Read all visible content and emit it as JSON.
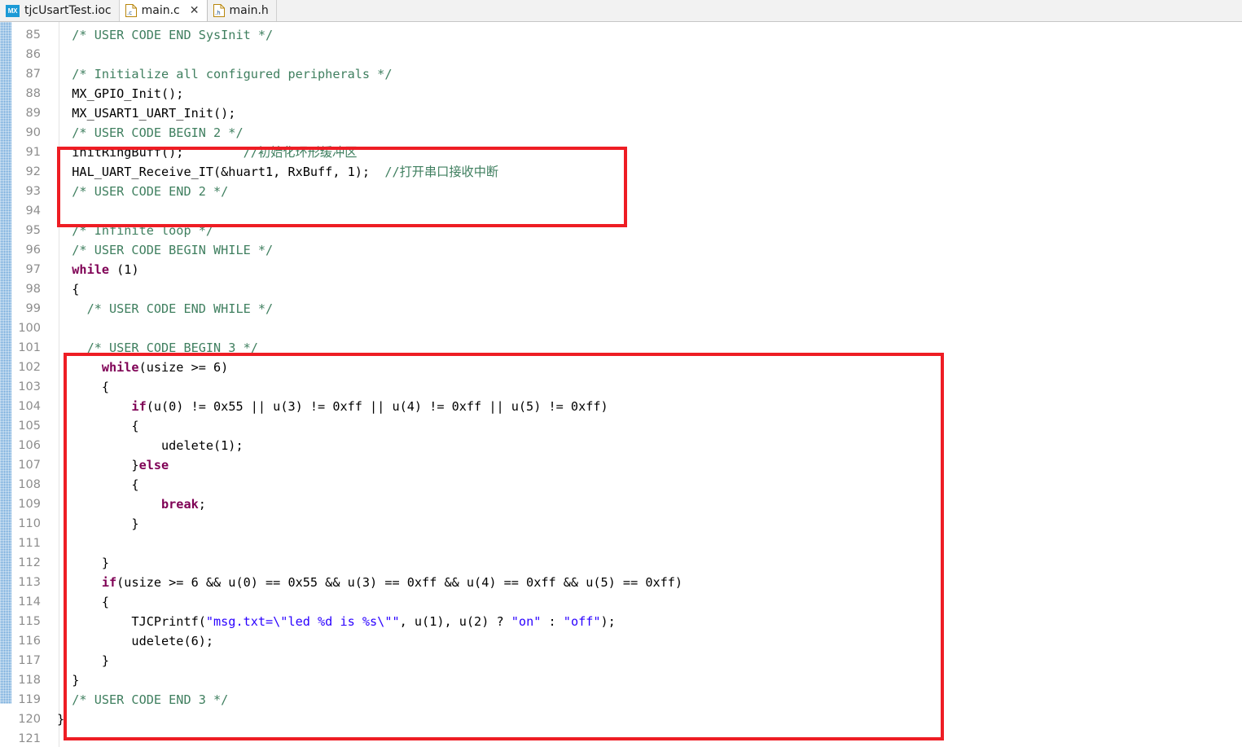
{
  "window": {
    "app": "Eclipse CDT editor",
    "file_type": "C source"
  },
  "tabs": [
    {
      "label": "tjcUsartTest.ioc",
      "icon": "cubemx-icon",
      "active": false,
      "closable": false
    },
    {
      "label": "main.c",
      "icon": "c-file-icon",
      "active": true,
      "closable": true,
      "close_glyph": "✕"
    },
    {
      "label": "main.h",
      "icon": "h-file-icon",
      "active": false,
      "closable": false
    }
  ],
  "colors": {
    "comment": "#3f7f5f",
    "keyword": "#7f0055",
    "string": "#2a00ff",
    "plain": "#000000",
    "line_number": "#8d8d8d",
    "annotation_box": "#ee1d24",
    "change_bar": "#5a9bd5",
    "editor_background": "#ffffff",
    "tabbar_background": "#f2f2f2"
  },
  "annotations": [
    {
      "name": "usercode-begin-2-highlight",
      "covers_lines": "90-93"
    },
    {
      "name": "usercode-begin-3-highlight",
      "covers_lines": "100-120"
    }
  ],
  "editor": {
    "first_visible_line": 85,
    "last_visible_line": 121,
    "lines": [
      {
        "n": "85",
        "tokens": [
          {
            "t": "cmt",
            "s": "  /* USER CODE END SysInit */"
          }
        ]
      },
      {
        "n": "86",
        "tokens": [
          {
            "t": "pl",
            "s": ""
          }
        ]
      },
      {
        "n": "87",
        "tokens": [
          {
            "t": "cmt",
            "s": "  /* Initialize all configured peripherals */"
          }
        ]
      },
      {
        "n": "88",
        "tokens": [
          {
            "t": "pl",
            "s": "  MX_GPIO_Init();"
          }
        ]
      },
      {
        "n": "89",
        "tokens": [
          {
            "t": "pl",
            "s": "  MX_USART1_UART_Init();"
          }
        ]
      },
      {
        "n": "90",
        "tokens": [
          {
            "t": "cmt",
            "s": "  /* USER CODE BEGIN 2 */"
          }
        ]
      },
      {
        "n": "91",
        "tokens": [
          {
            "t": "pl",
            "s": "  initRingBuff();        "
          },
          {
            "t": "cmt",
            "s": "//初始化环形缓冲区"
          }
        ]
      },
      {
        "n": "92",
        "tokens": [
          {
            "t": "pl",
            "s": "  HAL_UART_Receive_IT(&huart1, RxBuff, 1);  "
          },
          {
            "t": "cmt",
            "s": "//打开串口接收中断"
          }
        ]
      },
      {
        "n": "93",
        "tokens": [
          {
            "t": "cmt",
            "s": "  /* USER CODE END 2 */"
          }
        ]
      },
      {
        "n": "94",
        "tokens": [
          {
            "t": "pl",
            "s": ""
          }
        ]
      },
      {
        "n": "95",
        "tokens": [
          {
            "t": "cmt",
            "s": "  /* Infinite loop */"
          }
        ]
      },
      {
        "n": "96",
        "tokens": [
          {
            "t": "cmt",
            "s": "  /* USER CODE BEGIN WHILE */"
          }
        ]
      },
      {
        "n": "97",
        "tokens": [
          {
            "t": "kw",
            "s": "  while"
          },
          {
            "t": "pl",
            "s": " (1)"
          }
        ]
      },
      {
        "n": "98",
        "tokens": [
          {
            "t": "pl",
            "s": "  {"
          }
        ]
      },
      {
        "n": "99",
        "tokens": [
          {
            "t": "cmt",
            "s": "    /* USER CODE END WHILE */"
          }
        ]
      },
      {
        "n": "100",
        "tokens": [
          {
            "t": "pl",
            "s": ""
          }
        ]
      },
      {
        "n": "101",
        "tokens": [
          {
            "t": "cmt",
            "s": "    /* USER CODE BEGIN 3 */"
          }
        ]
      },
      {
        "n": "102",
        "tokens": [
          {
            "t": "kw",
            "s": "      while"
          },
          {
            "t": "pl",
            "s": "(usize >= 6)"
          }
        ]
      },
      {
        "n": "103",
        "tokens": [
          {
            "t": "pl",
            "s": "      {"
          }
        ]
      },
      {
        "n": "104",
        "tokens": [
          {
            "t": "kw",
            "s": "          if"
          },
          {
            "t": "pl",
            "s": "(u(0) != 0x55 || u(3) != 0xff || u(4) != 0xff || u(5) != 0xff)"
          }
        ]
      },
      {
        "n": "105",
        "tokens": [
          {
            "t": "pl",
            "s": "          {"
          }
        ]
      },
      {
        "n": "106",
        "tokens": [
          {
            "t": "pl",
            "s": "              udelete(1);"
          }
        ]
      },
      {
        "n": "107",
        "tokens": [
          {
            "t": "pl",
            "s": "          }"
          },
          {
            "t": "kw",
            "s": "else"
          }
        ]
      },
      {
        "n": "108",
        "tokens": [
          {
            "t": "pl",
            "s": "          {"
          }
        ]
      },
      {
        "n": "109",
        "tokens": [
          {
            "t": "pl",
            "s": "              "
          },
          {
            "t": "kw",
            "s": "break"
          },
          {
            "t": "pl",
            "s": ";"
          }
        ]
      },
      {
        "n": "110",
        "tokens": [
          {
            "t": "pl",
            "s": "          }"
          }
        ]
      },
      {
        "n": "111",
        "tokens": [
          {
            "t": "pl",
            "s": ""
          }
        ]
      },
      {
        "n": "112",
        "tokens": [
          {
            "t": "pl",
            "s": "      }"
          }
        ]
      },
      {
        "n": "113",
        "tokens": [
          {
            "t": "kw",
            "s": "      if"
          },
          {
            "t": "pl",
            "s": "(usize >= 6 && u(0) == 0x55 && u(3) == 0xff && u(4) == 0xff && u(5) == 0xff)"
          }
        ]
      },
      {
        "n": "114",
        "tokens": [
          {
            "t": "pl",
            "s": "      {"
          }
        ]
      },
      {
        "n": "115",
        "tokens": [
          {
            "t": "pl",
            "s": "          TJCPrintf("
          },
          {
            "t": "str",
            "s": "\"msg.txt=\\\"led %d is %s\\\"\""
          },
          {
            "t": "pl",
            "s": ", u(1), u(2) ? "
          },
          {
            "t": "str",
            "s": "\"on\""
          },
          {
            "t": "pl",
            "s": " : "
          },
          {
            "t": "str",
            "s": "\"off\""
          },
          {
            "t": "pl",
            "s": ");"
          }
        ]
      },
      {
        "n": "116",
        "tokens": [
          {
            "t": "pl",
            "s": "          udelete(6);"
          }
        ]
      },
      {
        "n": "117",
        "tokens": [
          {
            "t": "pl",
            "s": "      }"
          }
        ]
      },
      {
        "n": "118",
        "tokens": [
          {
            "t": "pl",
            "s": "  }"
          }
        ]
      },
      {
        "n": "119",
        "tokens": [
          {
            "t": "cmt",
            "s": "  /* USER CODE END 3 */"
          }
        ]
      },
      {
        "n": "120",
        "tokens": [
          {
            "t": "pl",
            "s": "}"
          }
        ]
      },
      {
        "n": "121",
        "tokens": [
          {
            "t": "pl",
            "s": ""
          }
        ]
      }
    ]
  }
}
